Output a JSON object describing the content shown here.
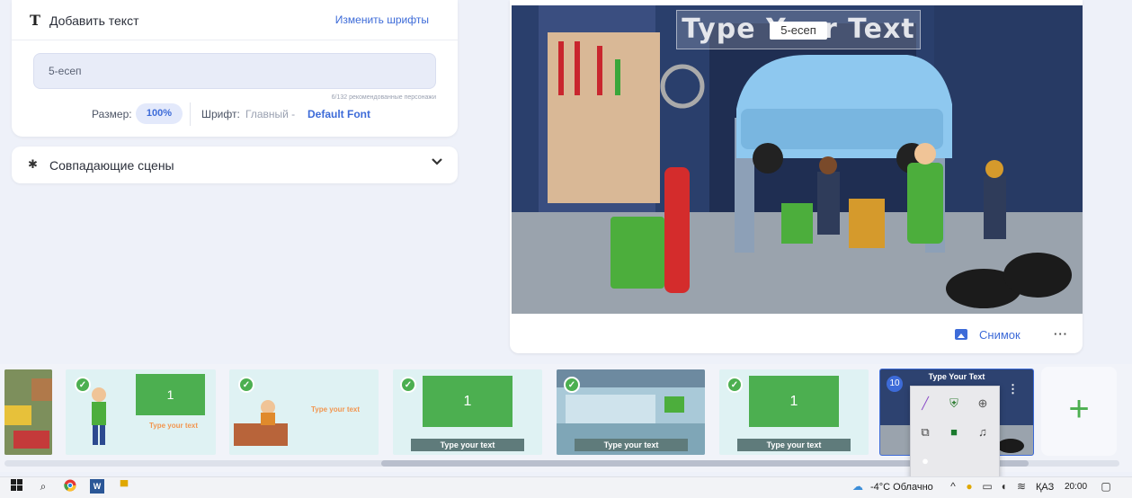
{
  "text_panel": {
    "icon": "T",
    "title": "Добавить текст",
    "change_fonts": "Изменить шрифты",
    "input_value": "5-есеп",
    "char_count": "6/132 рекомендованные персонажи",
    "size_label": "Размер:",
    "size_value": "100%",
    "font_label": "Шрифт:",
    "font_type": "Главный -",
    "font_name": "Default Font"
  },
  "scenes_panel": {
    "title": "Совпадающие сцены",
    "icon": "gear-icon",
    "chevron": "chevron-down-icon"
  },
  "preview": {
    "overlay_text": "Type Your Text",
    "edit_value": "5-есеп",
    "snapshot_label": "Снимок",
    "more": "···"
  },
  "timeline": {
    "thumbs": [
      {
        "board": "",
        "strip": ""
      },
      {
        "board": "1",
        "strip": "Type your text"
      },
      {
        "board": "",
        "strip": "Type your text"
      },
      {
        "board": "1",
        "strip": "Type your text"
      },
      {
        "board": "",
        "strip": "Type your text"
      },
      {
        "board": "1",
        "strip": "Type your text"
      },
      {
        "board": "",
        "strip": "Type Your Text"
      }
    ],
    "selected_number": "10",
    "add_label": "+"
  },
  "taskbar": {
    "weather": "-4°C Облачно",
    "language": "ҚАЗ",
    "time": "20:00"
  },
  "colors": {
    "accent": "#3d6bd8",
    "success": "#4caf50"
  }
}
